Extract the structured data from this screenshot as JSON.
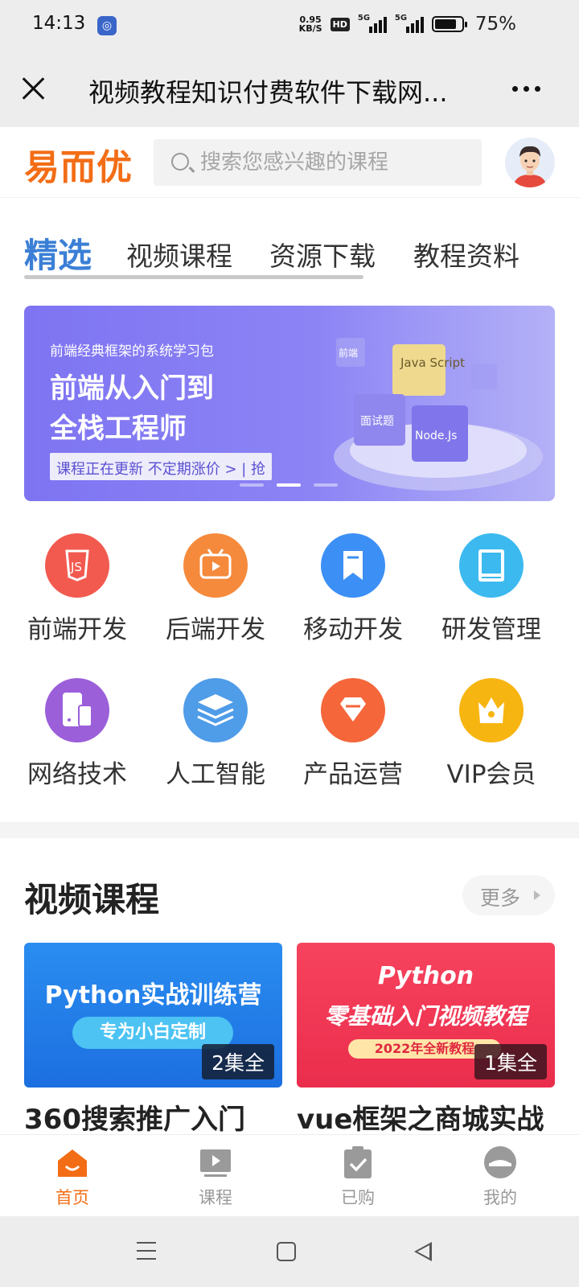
{
  "status_bar": {
    "time": "14:13",
    "speed_top": "0.95",
    "speed_bottom": "KB/S",
    "hd": "HD",
    "sig1": "5G",
    "sig2": "5G",
    "battery": "75%"
  },
  "title_bar": {
    "title": "视频教程知识付费软件下载网..."
  },
  "header": {
    "logo": "易而优",
    "search_placeholder": "搜索您感兴趣的课程"
  },
  "tabs": [
    {
      "label": "精选"
    },
    {
      "label": "视频课程"
    },
    {
      "label": "资源下载"
    },
    {
      "label": "教程资料"
    }
  ],
  "banner": {
    "subtitle": "前端经典框架的系统学习包",
    "title_line1": "前端从入门到",
    "title_line2": "全栈工程师",
    "tag": "课程正在更新 不定期涨价 > | 抢",
    "blocks": [
      "前端",
      "Java Script",
      "面试题",
      "Node.Js"
    ]
  },
  "categories": [
    {
      "label": "前端开发",
      "icon": "js-icon",
      "color": "#f25a4f"
    },
    {
      "label": "后端开发",
      "icon": "tv-icon",
      "color": "#f58a3c"
    },
    {
      "label": "移动开发",
      "icon": "bookmark-icon",
      "color": "#3c8ff5"
    },
    {
      "label": "研发管理",
      "icon": "book-icon",
      "color": "#3cb9ef"
    },
    {
      "label": "网络技术",
      "icon": "devices-icon",
      "color": "#9b5fd9"
    },
    {
      "label": "人工智能",
      "icon": "layers-icon",
      "color": "#4f9ce8"
    },
    {
      "label": "产品运营",
      "icon": "diamond-icon",
      "color": "#f5663a"
    },
    {
      "label": "VIP会员",
      "icon": "crown-icon",
      "color": "#f7b511"
    }
  ],
  "video_section": {
    "title": "视频课程",
    "more": "更多",
    "cards": [
      {
        "thumb_line1": "Python实战训练营",
        "thumb_line2": "专为小白定制",
        "episodes": "2集全",
        "title": "360搜索推广入门"
      },
      {
        "thumb_line1": "Python",
        "thumb_line2": "零基础入门视频教程",
        "thumb_line3": "2022年全新教程",
        "episodes": "1集全",
        "title": "vue框架之商城实战"
      }
    ]
  },
  "tab_bar": [
    {
      "label": "首页",
      "icon": "home-icon"
    },
    {
      "label": "课程",
      "icon": "video-icon"
    },
    {
      "label": "已购",
      "icon": "clipboard-check-icon"
    },
    {
      "label": "我的",
      "icon": "profile-icon"
    }
  ],
  "colors": {
    "accent": "#f36d16",
    "tab_active": "#3b7fd6",
    "banner": "#7e74f2"
  }
}
